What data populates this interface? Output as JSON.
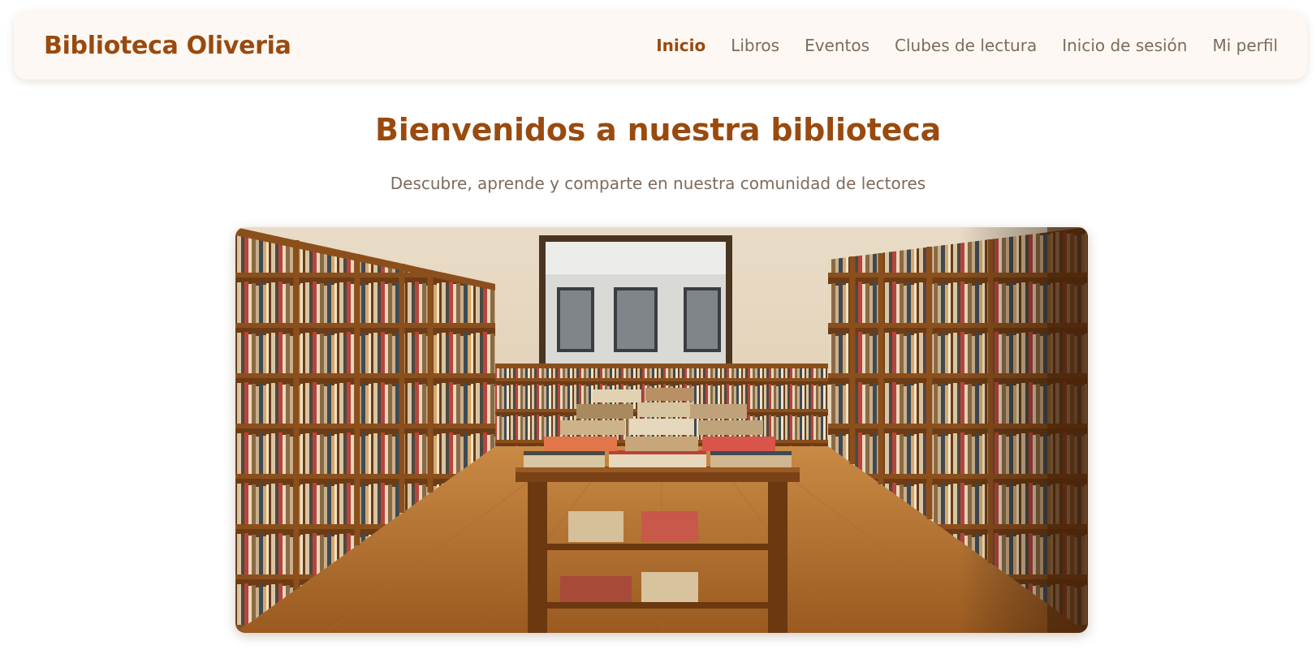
{
  "brand": {
    "name": "Biblioteca Oliveria"
  },
  "nav": {
    "items": [
      {
        "label": "Inicio",
        "active": true
      },
      {
        "label": "Libros",
        "active": false
      },
      {
        "label": "Eventos",
        "active": false
      },
      {
        "label": "Clubes de lectura",
        "active": false
      },
      {
        "label": "Inicio de sesión",
        "active": false
      },
      {
        "label": "Mi perfil",
        "active": false
      }
    ]
  },
  "hero": {
    "title": "Bienvenidos a nuestra biblioteca",
    "subtitle": "Descubre, aprende y comparte en nuestra comunidad de lectores",
    "image": {
      "subject": "library-interior-photo"
    }
  },
  "colors": {
    "accent": "#9a4a0e",
    "muted_text": "#7d6b5c",
    "nav_background": "#fdf8f3",
    "page_background": "#ffffff"
  }
}
